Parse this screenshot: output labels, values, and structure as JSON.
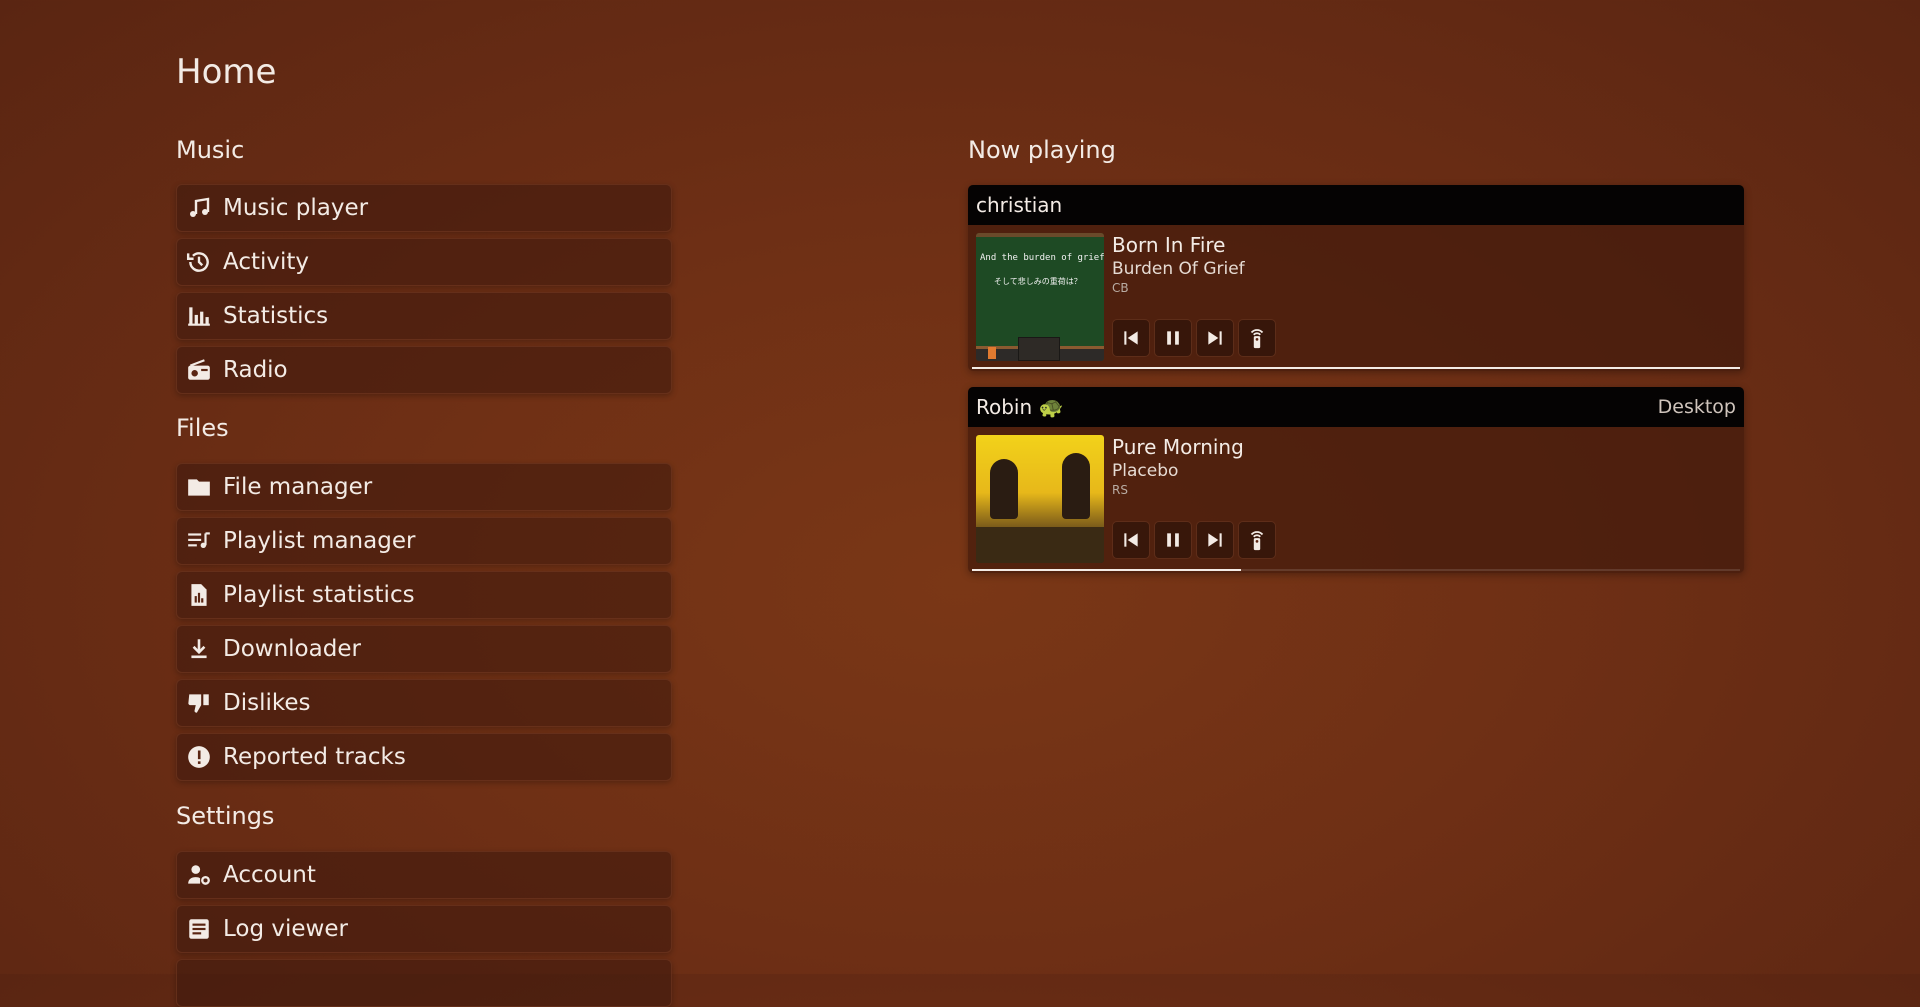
{
  "page": {
    "title": "Home"
  },
  "sections": {
    "music": {
      "title": "Music",
      "items": [
        {
          "label": "Music player",
          "icon": "music-note-icon"
        },
        {
          "label": "Activity",
          "icon": "history-icon"
        },
        {
          "label": "Statistics",
          "icon": "bar-chart-icon"
        },
        {
          "label": "Radio",
          "icon": "radio-icon"
        }
      ]
    },
    "files": {
      "title": "Files",
      "items": [
        {
          "label": "File manager",
          "icon": "folder-icon"
        },
        {
          "label": "Playlist manager",
          "icon": "playlist-icon"
        },
        {
          "label": "Playlist statistics",
          "icon": "file-chart-icon"
        },
        {
          "label": "Downloader",
          "icon": "download-icon"
        },
        {
          "label": "Dislikes",
          "icon": "thumb-down-icon"
        },
        {
          "label": "Reported tracks",
          "icon": "alert-circle-icon"
        }
      ]
    },
    "settings": {
      "title": "Settings",
      "items": [
        {
          "label": "Account",
          "icon": "account-settings-icon"
        },
        {
          "label": "Log viewer",
          "icon": "log-icon"
        }
      ]
    }
  },
  "now_playing": {
    "title": "Now playing",
    "players": [
      {
        "user": "christian",
        "device": "",
        "track": "Born In Fire",
        "artist": "Burden Of Grief",
        "source": "CB",
        "cover_text_1": "And the burden of grief ?",
        "cover_text_2": "そして悲しみの重荷は？",
        "progress": 1.0
      },
      {
        "user": "Robin 🐢",
        "device": "Desktop",
        "track": "Pure Morning",
        "artist": "Placebo",
        "source": "RS",
        "progress": 0.35
      }
    ]
  },
  "colors": {
    "accent": "#f3ebe5",
    "header_bg": "#050303",
    "bg": "#6e2f15"
  }
}
